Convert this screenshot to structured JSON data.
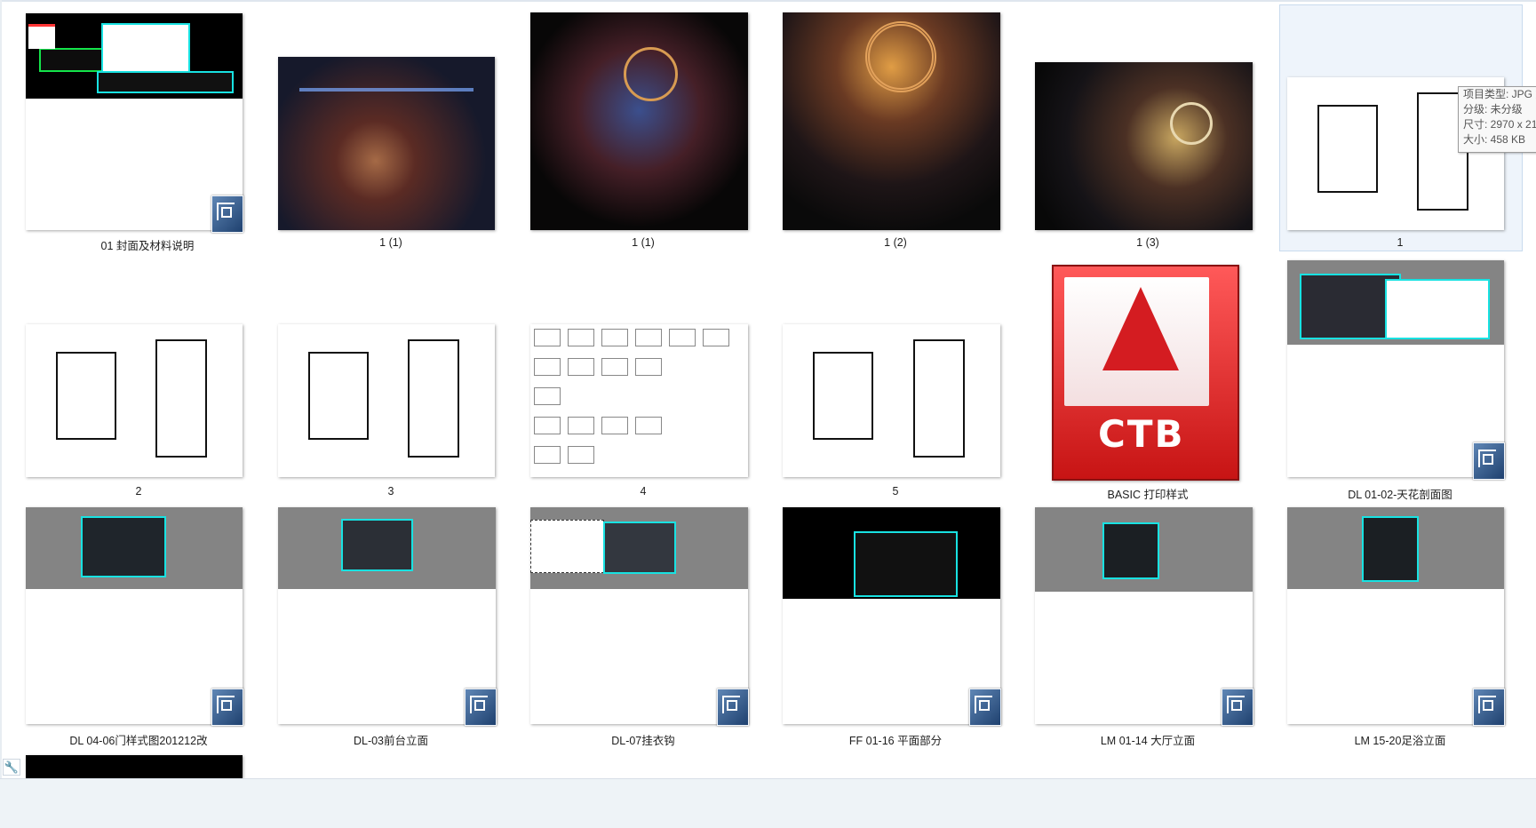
{
  "files": [
    {
      "name": "01 封面及材料说明",
      "type": "dwg"
    },
    {
      "name": "1 (1)",
      "type": "jpg"
    },
    {
      "name": "1 (1)",
      "type": "jpg"
    },
    {
      "name": "1 (2)",
      "type": "jpg"
    },
    {
      "name": "1 (3)",
      "type": "jpg"
    },
    {
      "name": "1",
      "type": "jpg"
    },
    {
      "name": "2",
      "type": "jpg"
    },
    {
      "name": "3",
      "type": "jpg"
    },
    {
      "name": "4",
      "type": "jpg"
    },
    {
      "name": "5",
      "type": "jpg"
    },
    {
      "name": "BASIC  打印样式",
      "type": "ctb",
      "icon_text": "CTB"
    },
    {
      "name": "DL 01-02-天花剖面图",
      "type": "dwg"
    },
    {
      "name": "DL 04-06门样式图201212改",
      "type": "dwg"
    },
    {
      "name": "DL-03前台立面",
      "type": "dwg"
    },
    {
      "name": "DL-07挂衣钩",
      "type": "dwg"
    },
    {
      "name": "FF 01-16 平面部分",
      "type": "dwg"
    },
    {
      "name": "LM 01-14 大厅立面",
      "type": "dwg"
    },
    {
      "name": "LM 15-20足浴立面",
      "type": "dwg"
    }
  ],
  "tooltip": {
    "lines": [
      "项目类型: JPG 文",
      "分级: 未分级",
      "尺寸: 2970 x 21",
      "大小: 458 KB"
    ]
  },
  "toolbar": {
    "wrench_icon": "wrench-icon"
  },
  "colors": {
    "selection": "#eef4fb",
    "selection_border": "#c9dbee",
    "cad_cyan": "#18e2e2",
    "ctb_red": "#d41c21"
  }
}
